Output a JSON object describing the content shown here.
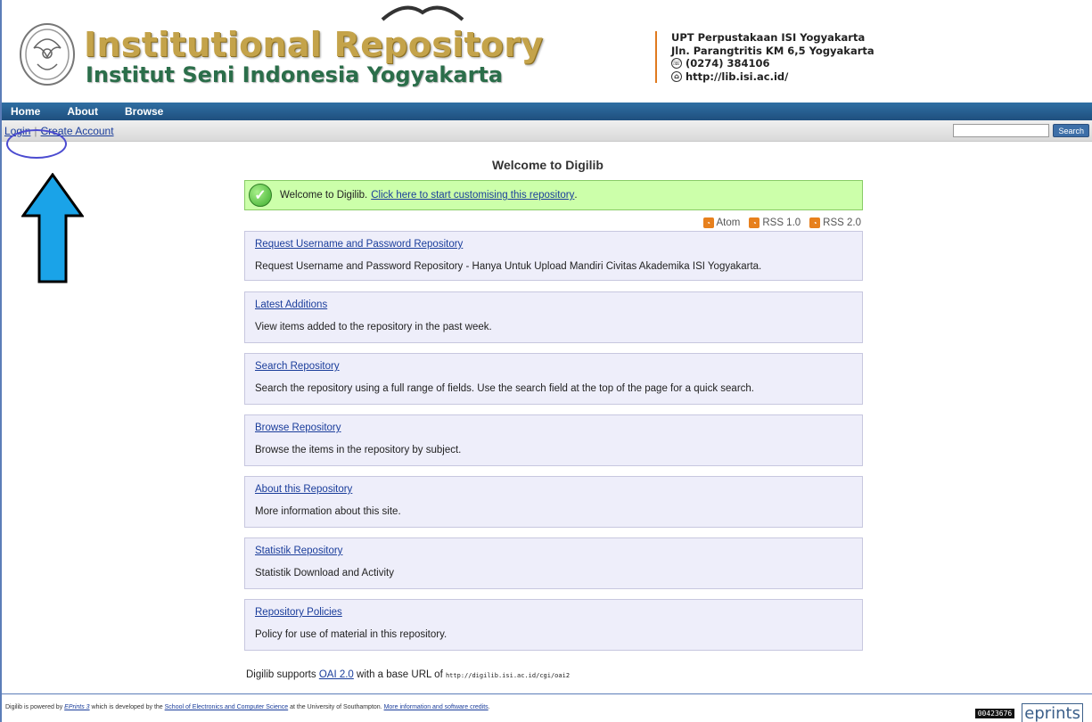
{
  "header": {
    "title_main": "Institutional Repository",
    "title_sub": "Institut Seni Indonesia Yogyakarta",
    "contact": {
      "line1": "UPT Perpustakaan ISI Yogyakarta",
      "line2": "Jln. Parangtritis KM 6,5 Yogyakarta",
      "phone": "(0274) 384106",
      "web": "http://lib.isi.ac.id/"
    }
  },
  "nav": {
    "home": "Home",
    "about": "About",
    "browse": "Browse"
  },
  "subbar": {
    "login": "Login",
    "separator": "|",
    "create_account": "Create Account",
    "search_button": "Search",
    "search_value": ""
  },
  "main": {
    "title": "Welcome to Digilib",
    "notice_text": "Welcome to Digilib.",
    "notice_link": "Click here to start customising this repository",
    "notice_end": ".",
    "feeds": [
      "Atom",
      "RSS 1.0",
      "RSS 2.0"
    ],
    "boxes": [
      {
        "link": "Request Username and Password Repository",
        "desc": "Request Username and Password Repository - Hanya Untuk Upload Mandiri Civitas Akademika ISI Yogyakarta."
      },
      {
        "link": "Latest Additions",
        "desc": "View items added to the repository in the past week."
      },
      {
        "link": "Search Repository",
        "desc": "Search the repository using a full range of fields. Use the search field at the top of the page for a quick search."
      },
      {
        "link": "Browse Repository",
        "desc": "Browse the items in the repository by subject."
      },
      {
        "link": "About this Repository",
        "desc": "More information about this site."
      },
      {
        "link": "Statistik Repository",
        "desc": "Statistik Download and Activity"
      },
      {
        "link": "Repository Policies",
        "desc": "Policy for use of material in this repository."
      }
    ],
    "oai_prefix": "Digilib supports",
    "oai_link": "OAI 2.0",
    "oai_mid": "with a base URL of",
    "oai_url": "http://digilib.isi.ac.id/cgi/oai2"
  },
  "footer": {
    "t1": "Digilib is powered by",
    "eprints_link": "EPrints 3",
    "t2": "which is developed by the",
    "school_link": "School of Electronics and Computer Science",
    "t3": "at the University of Southampton.",
    "credits_link": "More information and software credits",
    "t4": ".",
    "counter": "00423676",
    "brand": "eprints"
  },
  "colors": {
    "nav_bg": "#1f4f7e",
    "link": "#1a3d9b",
    "notice_bg": "#ccffaa",
    "box_bg": "#eeeefa",
    "annotation": "#4b4bd0",
    "arrow": "#1aa3e8"
  }
}
